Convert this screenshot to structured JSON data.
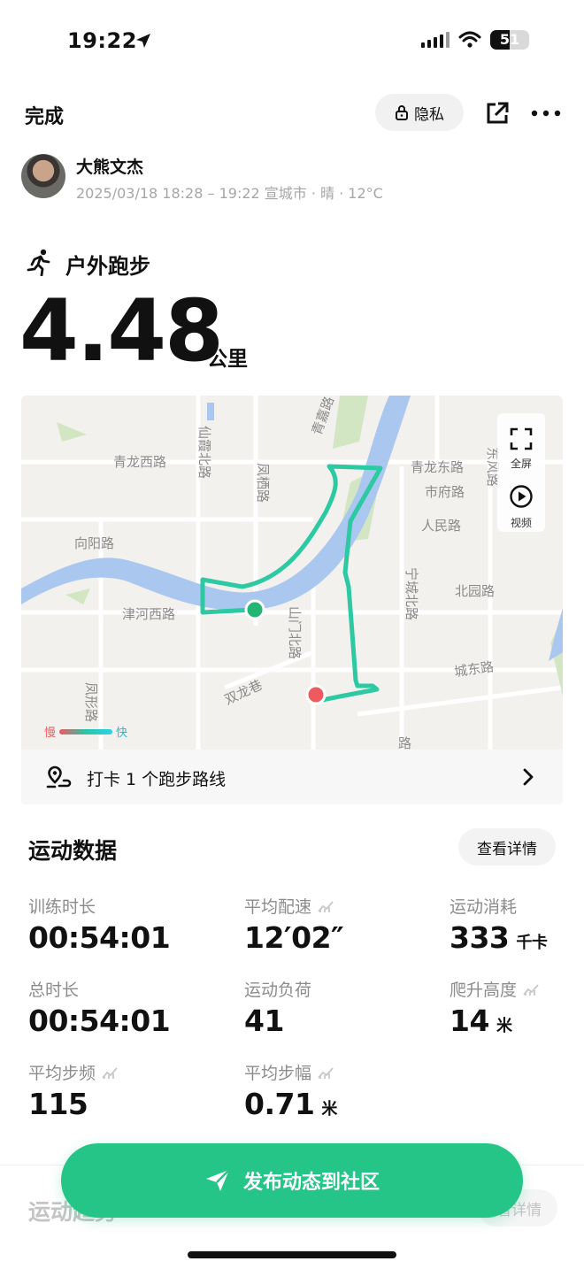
{
  "status_bar": {
    "time": "19:22",
    "battery_level": "51",
    "battery_fraction": 0.51
  },
  "header": {
    "done_label": "完成",
    "privacy_label": "隐私",
    "icons": [
      "lock-icon",
      "share-icon",
      "more-icon"
    ]
  },
  "user": {
    "name": "大熊文杰",
    "meta": "2025/03/18 18:28 – 19:22 宣城市 · 晴 · 12°C"
  },
  "activity": {
    "type": "户外跑步",
    "distance": "4.48",
    "unit": "公里"
  },
  "map": {
    "labels": {
      "qinglong_west": "青龙西路",
      "xianxia_north": "仙霞北路",
      "jing_rd": "青嘉路",
      "fengqi_rd": "凤栖路",
      "xiangyang_rd": "向阳路",
      "jinhe_west": "津河西路",
      "shanmen_north": "山门北路",
      "shuanglong_lane": "双龙巷",
      "fengxing_rd": "凤形路",
      "qinglong_east": "青龙东路",
      "shifu_rd": "市府路",
      "renmin_rd": "人民路",
      "dongfeng_rd": "东风路",
      "ningcheng_north": "宁城北路",
      "beiyuan_rd": "北园路",
      "chengdong_rd": "城东路",
      "bottom_rd": "路"
    },
    "fullscreen_label": "全屏",
    "video_label": "视频",
    "speed_slow": "慢",
    "speed_fast": "快",
    "route_color": "#2cc9a3",
    "start_color": "#23b573",
    "end_color": "#ef5a5f",
    "river_color": "#a9c7ef",
    "park_color": "#d2e6c3"
  },
  "checkin": {
    "text": "打卡 1 个跑步路线"
  },
  "stats": {
    "title": "运动数据",
    "detail_label": "查看详情",
    "items": [
      {
        "label": "训练时长",
        "value": "00:54:01",
        "unit": ""
      },
      {
        "label": "平均配速",
        "value": "12′02″",
        "unit": ""
      },
      {
        "label": "运动消耗",
        "value": "333",
        "unit": "千卡"
      },
      {
        "label": "总时长",
        "value": "00:54:01",
        "unit": ""
      },
      {
        "label": "运动负荷",
        "value": "41",
        "unit": ""
      },
      {
        "label": "爬升高度",
        "value": "14",
        "unit": "米"
      },
      {
        "label": "平均步频",
        "value": "115",
        "unit": ""
      },
      {
        "label": "平均步幅",
        "value": "0.71",
        "unit": "米"
      }
    ]
  },
  "trend": {
    "title": "运动趋势",
    "detail_label": "看详情"
  },
  "publish": {
    "label": "发布动态到社区"
  },
  "colors": {
    "accent": "#25c588",
    "muted": "#8c8c8c"
  }
}
